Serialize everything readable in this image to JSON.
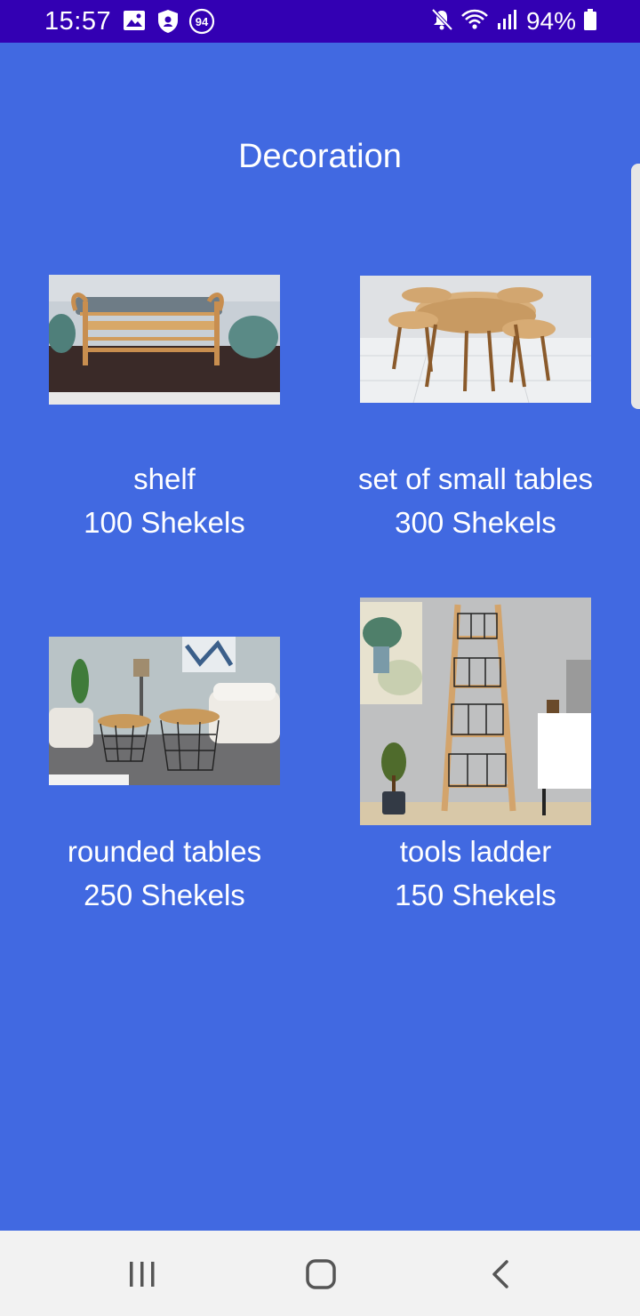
{
  "status_bar": {
    "time": "15:57",
    "notification_badge": "94",
    "battery_percent": "94%"
  },
  "page": {
    "title": "Decoration"
  },
  "products": [
    {
      "name": "shelf",
      "price": "100 Shekels",
      "image_icon": "bench-shelf-image"
    },
    {
      "name": "set of small tables",
      "price": "300 Shekels",
      "image_icon": "nesting-tables-image"
    },
    {
      "name": "rounded tables",
      "price": "250 Shekels",
      "image_icon": "round-wire-tables-image"
    },
    {
      "name": "tools ladder",
      "price": "150 Shekels",
      "image_icon": "ladder-shelf-image"
    }
  ],
  "nav_bar": {
    "buttons": [
      "recent-apps",
      "home",
      "back"
    ]
  },
  "colors": {
    "background": "#4169E1",
    "status_bar": "#3300b3",
    "nav_bar": "#f2f2f2",
    "text": "#ffffff"
  }
}
